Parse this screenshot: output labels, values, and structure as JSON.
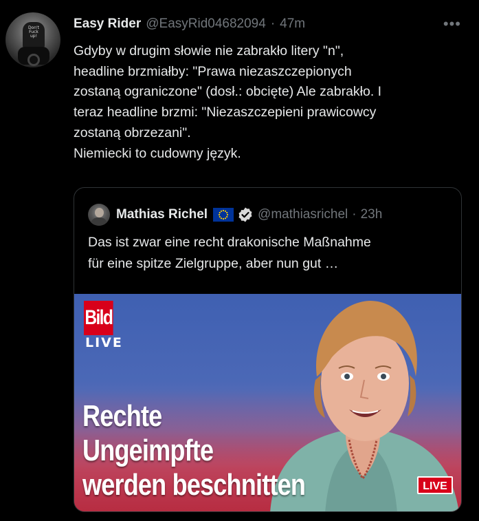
{
  "tweet": {
    "author_name": "Easy Rider",
    "author_handle": "@EasyRid04682094",
    "separator": "·",
    "time": "47m",
    "more_icon": "more-horizontal-icon",
    "avatar_text": "Don't\nFuck\nup!",
    "text": "Gdyby w drugim słowie nie zabrakło litery \"n\",\nheadline brzmiałby: \"Prawa niezaszczepionych\nzostaną ograniczone\" (dosł.: obcięte) Ale zabrakło. I\nteraz headline brzmi: \"Niezaszczepieni prawicowcy\nzostaną obrzezani\".\nNiemiecki to cudowny język."
  },
  "quoted_tweet": {
    "author_name": "Mathias Richel",
    "flag_icon": "eu-flag-icon",
    "verified_icon": "verified-badge-icon",
    "author_handle": "@mathiasrichel",
    "separator": "·",
    "time": "23h",
    "text": "Das ist zwar eine recht drakonische Maßnahme\nfür eine spitze Zielgruppe, aber nun gut …",
    "media": {
      "logo_text": "Bild",
      "logo_sub": "LIVE",
      "headline": "Rechte\nUngeimpfte\nwerden beschnitten",
      "live_badge": "LIVE",
      "colors": {
        "brand_red": "#d8001a",
        "background_blue": "#4b68b6"
      }
    }
  }
}
